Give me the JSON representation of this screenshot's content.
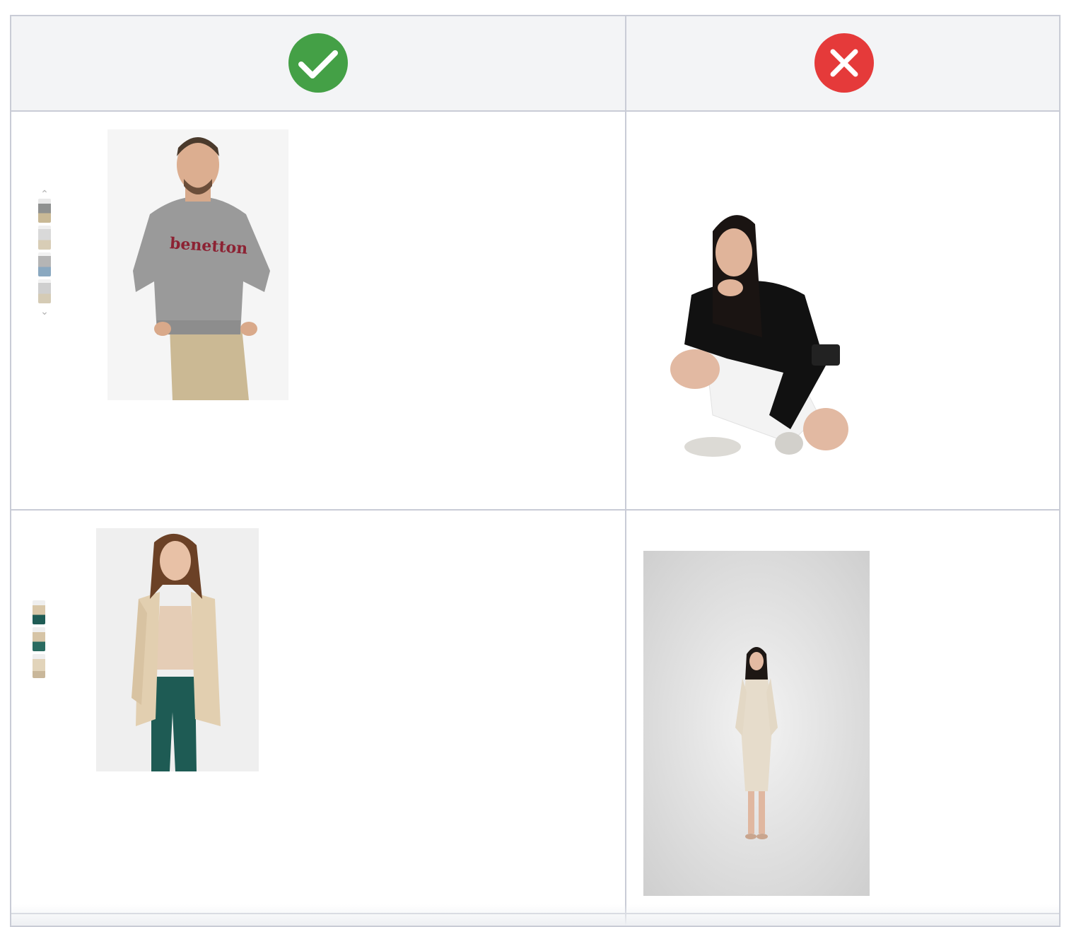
{
  "header": {
    "good_badge": {
      "icon": "checkmark-icon",
      "color": "#44a046"
    },
    "bad_badge": {
      "icon": "cross-icon",
      "color": "#e53a3a"
    }
  },
  "rows": [
    {
      "good": {
        "brand_text": "benetton",
        "thumbnail_count": 4
      },
      "bad": {}
    },
    {
      "good": {
        "thumbnail_count": 3
      },
      "bad": {}
    }
  ]
}
